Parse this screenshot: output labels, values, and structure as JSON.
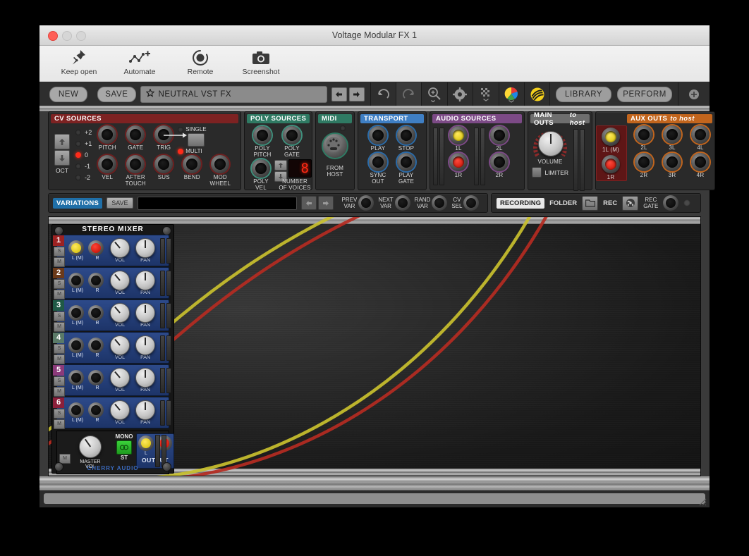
{
  "window": {
    "title": "Voltage Modular FX 1",
    "traffic": {
      "close": "close",
      "minimize": "minimize",
      "maximize": "maximize"
    }
  },
  "icon_toolbar": [
    {
      "name": "keep-open",
      "label": "Keep open",
      "icon": "pin-icon"
    },
    {
      "name": "automate",
      "label": "Automate",
      "icon": "automation-curve-icon"
    },
    {
      "name": "remote",
      "label": "Remote",
      "icon": "remote-circle-icon"
    },
    {
      "name": "screenshot",
      "label": "Screenshot",
      "icon": "camera-icon"
    }
  ],
  "strip": {
    "new_label": "NEW",
    "save_label": "SAVE",
    "preset_name": "NEUTRAL VST FX",
    "preset_star": "star-icon",
    "prev_label": "prev-preset-icon",
    "next_label": "next-preset-icon",
    "library_label": "LIBRARY",
    "perform_label": "PERFORM",
    "icons": [
      "undo-icon",
      "redo-icon",
      "zoom-icon",
      "gear-icon",
      "grid-icon",
      "color-wheel-icon",
      "cable-icon",
      "add-icon"
    ]
  },
  "cv_sources": {
    "title": "CV SOURCES",
    "oct_label": "OCT",
    "oct_up": "arrow-up-icon",
    "oct_down": "arrow-down-icon",
    "oct_leds": [
      {
        "label": "+2",
        "on": false
      },
      {
        "label": "+1",
        "on": false
      },
      {
        "label": "0",
        "on": true
      },
      {
        "label": "-1",
        "on": false
      },
      {
        "label": "-2",
        "on": false
      }
    ],
    "single_label": "SINGLE",
    "multi_label": "MULTI",
    "single_on": false,
    "multi_on": true,
    "jacks_row1": [
      "PITCH",
      "GATE",
      "TRIG"
    ],
    "jacks_row2": [
      "VEL",
      "AFTER\nTOUCH",
      "SUS",
      "BEND",
      "MOD\nWHEEL"
    ]
  },
  "poly_sources": {
    "title": "POLY SOURCES",
    "jacks": [
      "POLY\nPITCH",
      "POLY\nGATE",
      "POLY\nVEL"
    ],
    "voices_label": "NUMBER\nOF VOICES",
    "voices_value": "8",
    "voices_up": "arrow-up-icon",
    "voices_down": "arrow-down-icon"
  },
  "midi": {
    "title": "MIDI",
    "jack_label": "FROM\nHOST",
    "led_on": false
  },
  "transport": {
    "title": "TRANSPORT",
    "jacks": [
      "PLAY",
      "STOP",
      "SYNC\nOUT",
      "PLAY\nGATE"
    ]
  },
  "audio_sources": {
    "title": "AUDIO SOURCES",
    "jacks": [
      {
        "label": "1L",
        "lit": "yellow"
      },
      {
        "label": "2L",
        "lit": "none"
      },
      {
        "label": "1R",
        "lit": "red"
      },
      {
        "label": "2R",
        "lit": "none"
      }
    ]
  },
  "main_outs": {
    "title": "MAIN OUTS",
    "title_suffix": "to host",
    "volume_label": "VOLUME",
    "limiter_label": "LIMITER",
    "limiter_on": false,
    "volume_angle": 0
  },
  "aux_outs": {
    "title": "AUX OUTS",
    "title_suffix": "to host",
    "jacks": [
      {
        "label": "1L (M)",
        "lit": "yellow"
      },
      {
        "label": "2L",
        "lit": "none"
      },
      {
        "label": "3L",
        "lit": "none"
      },
      {
        "label": "4L",
        "lit": "none"
      },
      {
        "label": "1R",
        "lit": "red"
      },
      {
        "label": "2R",
        "lit": "none"
      },
      {
        "label": "3R",
        "lit": "none"
      },
      {
        "label": "4R",
        "lit": "none"
      }
    ]
  },
  "variations": {
    "title": "VARIATIONS",
    "save_label": "SAVE",
    "field_value": "",
    "prev_icon": "arrow-left-icon",
    "next_icon": "arrow-right-icon",
    "jacks": [
      "PREV\nVAR",
      "NEXT\nVAR",
      "RAND\nVAR",
      "CV\nSEL"
    ]
  },
  "recording": {
    "title": "RECORDING",
    "folder_label": "FOLDER",
    "folder_icon": "folder-icon",
    "rec_label": "REC",
    "rec_icon": "record-icon",
    "rec_gate_label": "REC\nGATE"
  },
  "mixer": {
    "title": "STEREO MIXER",
    "brand": "CHERRY AUDIO",
    "solo_label": "S",
    "mute_label": "M",
    "vol_label": "VOL",
    "pan_label": "PAN",
    "l_label": "L (M)",
    "r_label": "R",
    "channels": [
      {
        "num": "1",
        "color": "#9c2222",
        "l_lit": "yellow",
        "r_lit": "red",
        "vol_angle": -40,
        "pan_angle": 0
      },
      {
        "num": "2",
        "color": "#6b3a1a",
        "l_lit": "none",
        "r_lit": "none",
        "vol_angle": -40,
        "pan_angle": 0
      },
      {
        "num": "3",
        "color": "#1f5a46",
        "l_lit": "none",
        "r_lit": "none",
        "vol_angle": -40,
        "pan_angle": 0
      },
      {
        "num": "4",
        "color": "#5a7a68",
        "l_lit": "none",
        "r_lit": "none",
        "vol_angle": -40,
        "pan_angle": 0
      },
      {
        "num": "5",
        "color": "#8b3a7a",
        "l_lit": "none",
        "r_lit": "none",
        "vol_angle": -40,
        "pan_angle": 0
      },
      {
        "num": "6",
        "color": "#8b1f3a",
        "l_lit": "none",
        "r_lit": "none",
        "vol_angle": -40,
        "pan_angle": 0
      }
    ],
    "master": {
      "master_vol_label": "MASTER\nVOL",
      "mono_label": "MONO",
      "st_label": "ST",
      "mono_st_icon": "mono-stereo-icon",
      "output_label": "OUTPUT",
      "out_l_label": "L",
      "out_r_label": "R",
      "out_l_lit": "yellow",
      "out_r_lit": "red",
      "master_angle": -35
    }
  },
  "cables": [
    {
      "color": "#c9c02e",
      "name": "cable-yellow-left"
    },
    {
      "color": "#b52b22",
      "name": "cable-red-left"
    },
    {
      "color": "#c9c02e",
      "name": "cable-yellow-right"
    },
    {
      "color": "#b52b22",
      "name": "cable-red-right"
    }
  ],
  "colors": {
    "cv_header": "#7d2222",
    "poly_header": "#2f7a63",
    "midi_header": "#2f7a63",
    "transport_header": "#3f7fc4",
    "audio_header": "#7c4a86",
    "main_header": "#6e6e6e",
    "aux_header": "#c2651d",
    "variations_header": "#1f6fa8",
    "mixer_channel": "#2d4a8a"
  }
}
